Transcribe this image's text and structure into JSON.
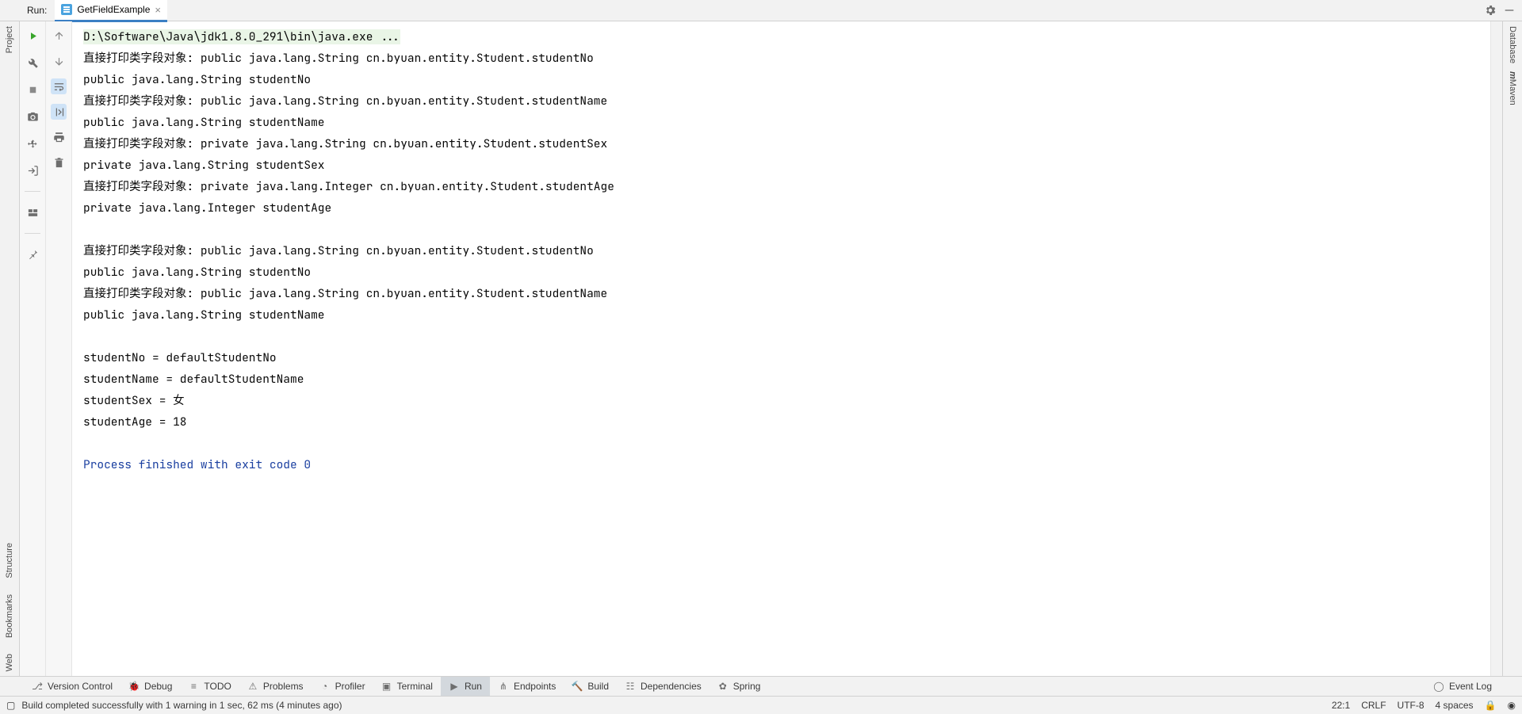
{
  "header": {
    "run_label": "Run:",
    "tab_title": "GetFieldExample"
  },
  "left_rail": {
    "project": "Project",
    "structure": "Structure",
    "bookmarks": "Bookmarks",
    "web": "Web"
  },
  "right_rail": {
    "database": "Database",
    "maven": "Maven"
  },
  "console": {
    "cmd": "D:\\Software\\Java\\jdk1.8.0_291\\bin\\java.exe ...",
    "l1": "直接打印类字段对象: public java.lang.String cn.byuan.entity.Student.studentNo",
    "l2": "public java.lang.String studentNo",
    "l3": "直接打印类字段对象: public java.lang.String cn.byuan.entity.Student.studentName",
    "l4": "public java.lang.String studentName",
    "l5": "直接打印类字段对象: private java.lang.String cn.byuan.entity.Student.studentSex",
    "l6": "private java.lang.String studentSex",
    "l7": "直接打印类字段对象: private java.lang.Integer cn.byuan.entity.Student.studentAge",
    "l8": "private java.lang.Integer studentAge",
    "l9": "",
    "l10": "直接打印类字段对象: public java.lang.String cn.byuan.entity.Student.studentNo",
    "l11": "public java.lang.String studentNo",
    "l12": "直接打印类字段对象: public java.lang.String cn.byuan.entity.Student.studentName",
    "l13": "public java.lang.String studentName",
    "l14": "",
    "l15": "studentNo = defaultStudentNo",
    "l16": "studentName = defaultStudentName",
    "l17": "studentSex = 女",
    "l18": "studentAge = 18",
    "l19": "",
    "proc": "Process finished with exit code 0"
  },
  "bottom_tabs": {
    "version_control": "Version Control",
    "debug": "Debug",
    "todo": "TODO",
    "problems": "Problems",
    "profiler": "Profiler",
    "terminal": "Terminal",
    "run": "Run",
    "endpoints": "Endpoints",
    "build": "Build",
    "dependencies": "Dependencies",
    "spring": "Spring",
    "event_log": "Event Log"
  },
  "status": {
    "msg": "Build completed successfully with 1 warning in 1 sec, 62 ms (4 minutes ago)",
    "pos": "22:1",
    "lineend": "CRLF",
    "encoding": "UTF-8",
    "indent": "4 spaces"
  }
}
